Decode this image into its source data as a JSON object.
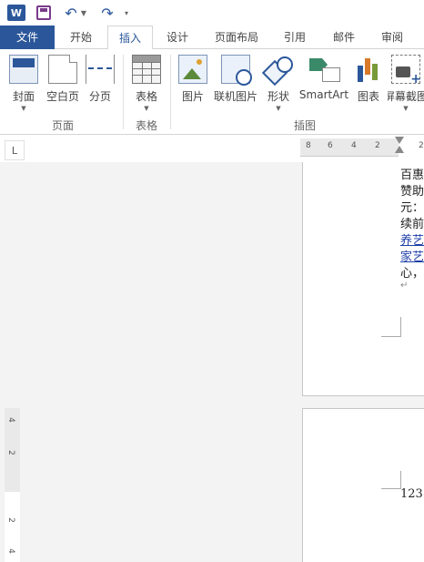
{
  "qat": {
    "app_logo": "W",
    "icons": [
      "word-logo-icon",
      "save-icon",
      "undo-icon",
      "redo-icon",
      "customize-icon"
    ]
  },
  "tabs": [
    "文件",
    "开始",
    "插入",
    "设计",
    "页面布局",
    "引用",
    "邮件",
    "审阅"
  ],
  "active_tab": "插入",
  "ribbon": {
    "pages": {
      "cover": "封面",
      "blank": "空白页",
      "break": "分页",
      "group": "页面"
    },
    "tables": {
      "table": "表格",
      "group": "表格"
    },
    "illustrations": {
      "picture": "图片",
      "online_picture": "联机图片",
      "shapes": "形状",
      "smartart": "SmartArt",
      "chart": "图表",
      "screenshot": "屏幕截图",
      "group": "插图"
    }
  },
  "ruler": {
    "corner": "L",
    "ticks": [
      "8",
      "6",
      "4",
      "2",
      "2"
    ],
    "vticks": [
      "4",
      "2",
      "2",
      "4"
    ]
  },
  "document": {
    "page1_lines": [
      "百惠",
      "赞助",
      "元：",
      "续前",
      "养艺",
      "家艺",
      "心，"
    ],
    "paragraph_mark": "↵",
    "page2_text": "123↵"
  },
  "colors": {
    "accent": "#2b579a",
    "file_tab": "#2b579a",
    "link_blue": "#1f3fa8"
  }
}
